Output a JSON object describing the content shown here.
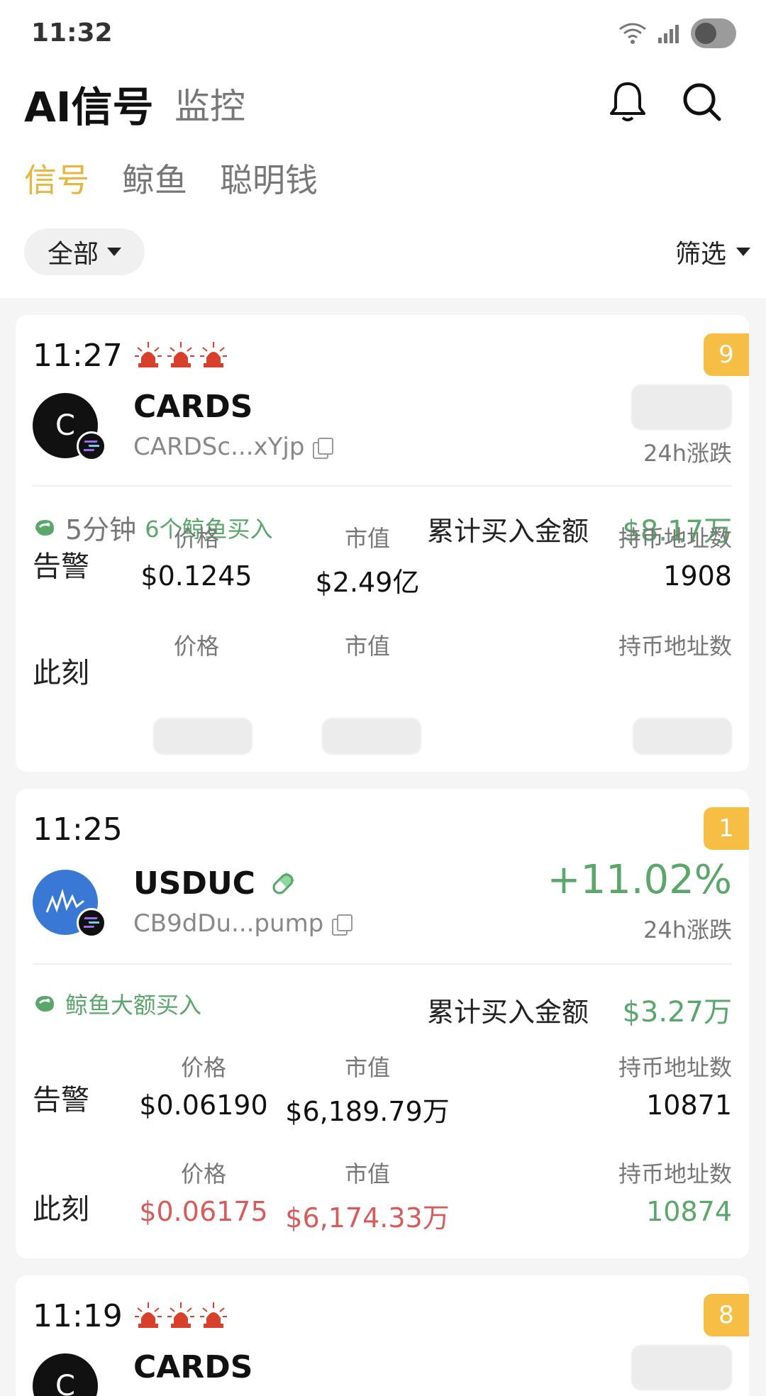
{
  "status": {
    "time": "11:32"
  },
  "header": {
    "title": "AI信号",
    "subtitle": "监控"
  },
  "subtabs": [
    {
      "label": "信号",
      "active": true
    },
    {
      "label": "鲸鱼",
      "active": false
    },
    {
      "label": "聪明钱",
      "active": false
    }
  ],
  "filter": {
    "scope": "全部",
    "filter_label": "筛选"
  },
  "colors": {
    "accent": "#e8b63c",
    "badge": "#f6be45",
    "up": "#5aa66b",
    "down": "#d85b5b"
  },
  "cards": [
    {
      "time": "11:27",
      "alarms": 3,
      "rank": "9",
      "avatar_letter": "C",
      "token": "CARDS",
      "address": "CARDSc...xYjp",
      "change": "",
      "change_label": "24h涨跌",
      "duration": "5分钟",
      "signal": "6个鲸鱼买入",
      "cum_label": "累计买入金额",
      "cum_value": "$8.17万",
      "alert": {
        "label": "告警",
        "price_h": "价格",
        "price": "$0.1245",
        "mcap_h": "市值",
        "mcap": "$2.49亿",
        "holders_h": "持币地址数",
        "holders": "1908"
      },
      "now": {
        "label": "此刻",
        "price_h": "价格",
        "price": "",
        "mcap_h": "市值",
        "mcap": "",
        "holders_h": "持币地址数",
        "holders": ""
      }
    },
    {
      "time": "11:25",
      "alarms": 0,
      "rank": "1",
      "avatar_letter": "",
      "token": "USDUC",
      "address": "CB9dDu...pump",
      "change": "+11.02%",
      "change_label": "24h涨跌",
      "duration": "",
      "signal": "鲸鱼大额买入",
      "cum_label": "累计买入金额",
      "cum_value": "$3.27万",
      "alert": {
        "label": "告警",
        "price_h": "价格",
        "price": "$0.06190",
        "mcap_h": "市值",
        "mcap": "$6,189.79万",
        "holders_h": "持币地址数",
        "holders": "10871"
      },
      "now": {
        "label": "此刻",
        "price_h": "价格",
        "price": "$0.06175",
        "mcap_h": "市值",
        "mcap": "$6,174.33万",
        "holders_h": "持币地址数",
        "holders": "10874"
      }
    },
    {
      "time": "11:19",
      "alarms": 3,
      "rank": "8",
      "avatar_letter": "C",
      "token": "CARDS"
    }
  ]
}
